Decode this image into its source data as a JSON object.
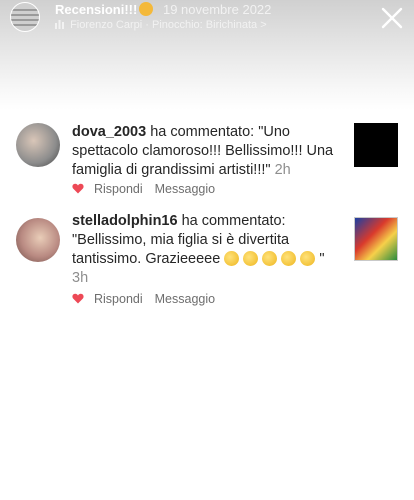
{
  "story": {
    "title": "Recensioni!!!",
    "date": "19 novembre 2022",
    "music": "Fiorenzo Carpi · Pinocchio: Birichinata >"
  },
  "comments": [
    {
      "username": "dova_2003",
      "text_before": " ha commentato: \"Uno spettacolo clamoroso!!! Bellissimo!!! Una famiglia di grandissimi artisti!!!\" ",
      "time": "2h",
      "reply_label": "Rispondi",
      "message_label": "Messaggio"
    },
    {
      "username": "stelladolphin16",
      "text_before": " ha commentato: \"Bellissimo,  mia figlia si è divertita tantissimo.  Grazieeeee ",
      "text_after": "\" ",
      "time": "3h",
      "reply_label": "Rispondi",
      "message_label": "Messaggio"
    }
  ],
  "colors": {
    "heart": "#ed4956",
    "username": "#262626",
    "meta": "#8e8e8e"
  },
  "icons": [
    "close-icon",
    "music-icon",
    "heart-icon",
    "clap-emoji",
    "smile-emoji"
  ]
}
